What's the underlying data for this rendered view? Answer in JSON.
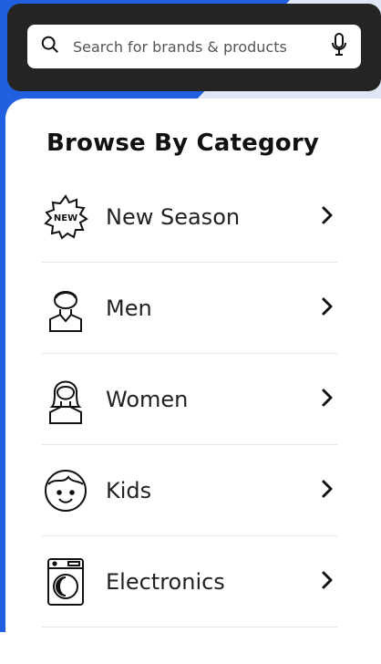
{
  "search": {
    "placeholder": "Search for brands & products"
  },
  "title": "Browse By Category",
  "categories": [
    {
      "label": "New Season",
      "icon": "new-badge-icon"
    },
    {
      "label": "Men",
      "icon": "man-icon"
    },
    {
      "label": "Women",
      "icon": "woman-icon"
    },
    {
      "label": "Kids",
      "icon": "kid-face-icon"
    },
    {
      "label": "Electronics",
      "icon": "washing-machine-icon"
    }
  ],
  "colors": {
    "accent_blue": "#1f5fe0",
    "header": "#242424"
  }
}
